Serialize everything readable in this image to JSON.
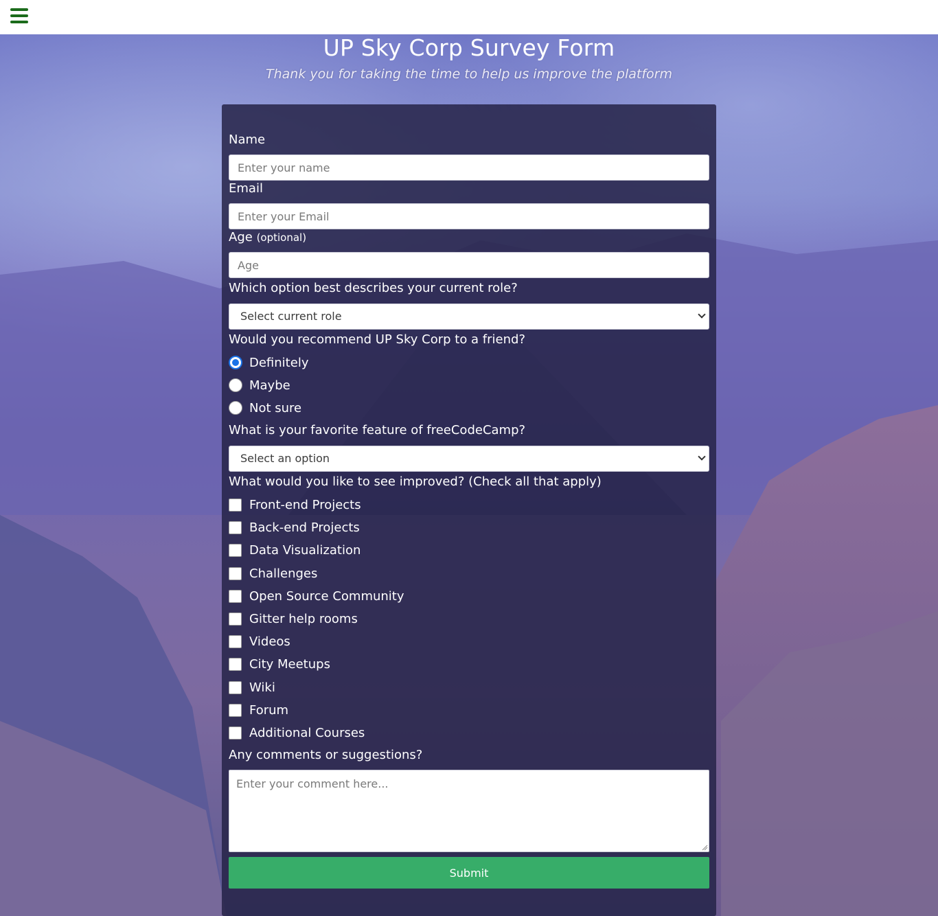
{
  "header": {
    "menu_icon": "hamburger-menu-icon"
  },
  "page": {
    "title": "UP Sky Corp Survey Form",
    "subtitle": "Thank you for taking the time to help us improve the platform"
  },
  "form": {
    "name": {
      "label": "Name",
      "placeholder": "Enter your name"
    },
    "email": {
      "label": "Email",
      "placeholder": "Enter your Email"
    },
    "age": {
      "label": "Age",
      "label_note": "(optional)",
      "placeholder": "Age"
    },
    "role": {
      "label": "Which option best describes your current role?",
      "selected": "Select current role"
    },
    "recommend": {
      "label": "Would you recommend UP Sky Corp to a friend?",
      "options": [
        "Definitely",
        "Maybe",
        "Not sure"
      ],
      "selected": "Definitely"
    },
    "favorite": {
      "label": "What is your favorite feature of freeCodeCamp?",
      "selected": "Select an option"
    },
    "improve": {
      "label": "What would you like to see improved? (Check all that apply)",
      "options": [
        "Front-end Projects",
        "Back-end Projects",
        "Data Visualization",
        "Challenges",
        "Open Source Community",
        "Gitter help rooms",
        "Videos",
        "City Meetups",
        "Wiki",
        "Forum",
        "Additional Courses"
      ]
    },
    "comments": {
      "label": "Any comments or suggestions?",
      "placeholder": "Enter your comment here..."
    },
    "submit_label": "Submit"
  },
  "colors": {
    "submit_bg": "#37ad69",
    "radio_accent": "#1a73e8",
    "menu_icon": "#1b6b1b",
    "card_bg": "#262448"
  }
}
